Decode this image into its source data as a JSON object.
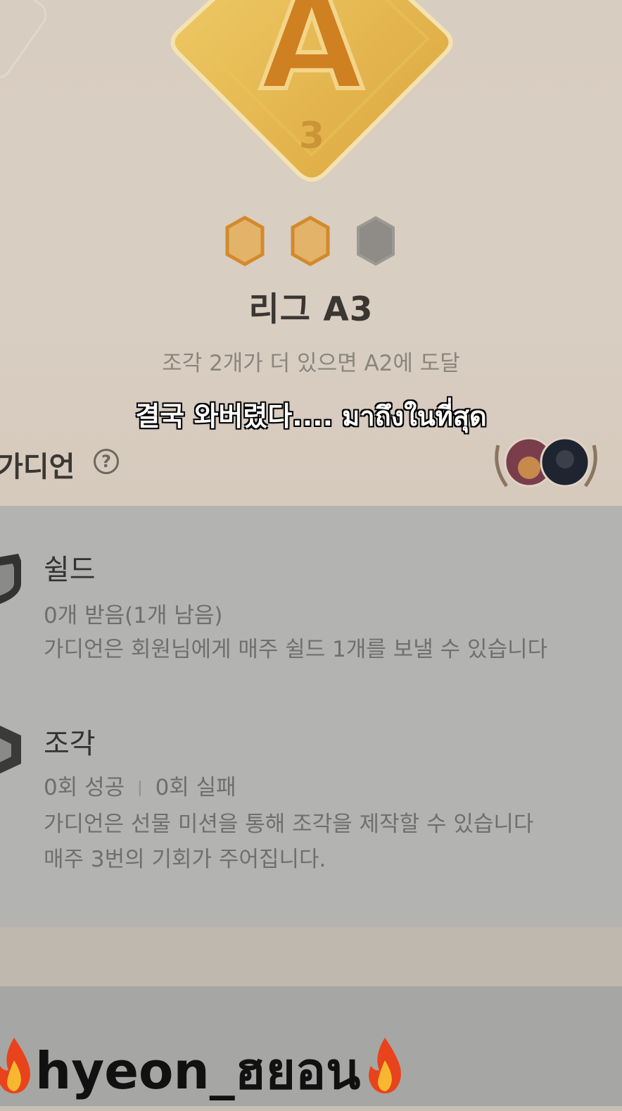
{
  "league": {
    "badge_letter": "A",
    "badge_number": "3",
    "title": "리그 A3",
    "subtitle": "조각 2개가 더 있으면 A2에 도달",
    "pieces": [
      "filled",
      "filled",
      "empty"
    ]
  },
  "caption": "결국 와버렸다.... มาถึงในที่สุด",
  "guardian": {
    "title": "가디언",
    "help_icon": "?"
  },
  "shield": {
    "title": "쉴드",
    "status": "0개 받음(1개 남음)",
    "description": "가디언은 회원님에게 매주 쉴드 1개를 보낼 수 있습니다"
  },
  "fragment": {
    "title": "조각",
    "success": "0회 성공",
    "separator": "|",
    "fail": "0회 실패",
    "description_1": "가디언은 선물 미션을 통해 조각을 제작할 수 있습니다",
    "description_2": "매주 3번의 기회가 주어집니다."
  },
  "watermark": {
    "text": "hyeon_ฮยอน"
  },
  "colors": {
    "badge_gold": "#e5b64a",
    "badge_letter": "#cf8021",
    "piece_orange": "#d38a2b",
    "piece_empty": "#8f8b86"
  }
}
